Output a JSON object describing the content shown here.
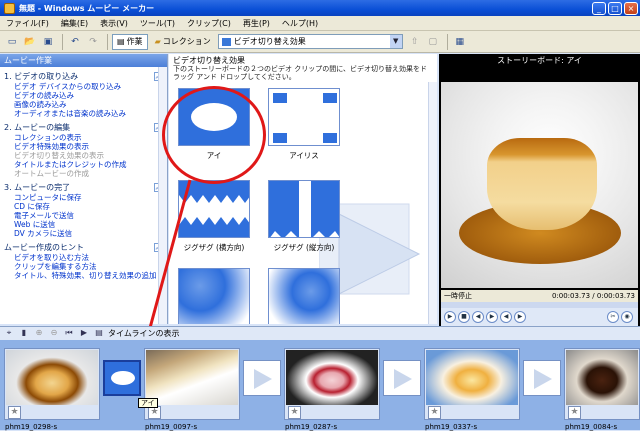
{
  "window": {
    "title": "無題 - Windows ムービー メーカー",
    "min": "_",
    "max": "□",
    "close": "×"
  },
  "menu": [
    "ファイル(F)",
    "編集(E)",
    "表示(V)",
    "ツール(T)",
    "クリップ(C)",
    "再生(P)",
    "ヘルプ(H)"
  ],
  "toolbar": {
    "tasks_label": "作業",
    "collections_label": "コレクション",
    "current_collection": "ビデオ切り替え効果"
  },
  "taskpane": {
    "title": "ムービー作業",
    "sections": [
      {
        "title": "1. ビデオの取り込み",
        "links": [
          "ビデオ デバイスからの取り込み",
          "ビデオの読み込み",
          "画像の読み込み",
          "オーディオまたは音楽の読み込み"
        ]
      },
      {
        "title": "2. ムービーの編集",
        "links": [
          "コレクションの表示",
          "ビデオ特殊効果の表示",
          "ビデオ切り替え効果の表示",
          "タイトルまたはクレジットの作成",
          "オートムービーの作成"
        ]
      },
      {
        "title": "3. ムービーの完了",
        "links": [
          "コンピュータに保存",
          "CD に保存",
          "電子メールで送信",
          "Web に送信",
          "DV カメラに送信"
        ]
      },
      {
        "title": "ムービー作成のヒント",
        "links": [
          "ビデオを取り込む方法",
          "クリップを編集する方法",
          "タイトル、特殊効果、切り替え効果の追加"
        ]
      }
    ]
  },
  "content": {
    "title": "ビデオ切り替え効果",
    "description": "下のストーリーボードの２つのビデオ クリップの間に、ビデオ切り替え効果をドラッグ アンド ドロップしてください。",
    "tiles": [
      {
        "label": "アイ"
      },
      {
        "label": "アイリス"
      },
      {
        "label": "ジグザグ (横方向)"
      },
      {
        "label": "ジグザグ (縦方向)"
      },
      {
        "label": ""
      },
      {
        "label": ""
      }
    ]
  },
  "preview": {
    "title": "ストーリーボード: アイ",
    "status": "一時停止",
    "time": "0:00:03.73 / 0:00:03.73"
  },
  "storyboard": {
    "timeline_label": "タイムラインの表示",
    "clips": [
      {
        "name": "phm19_0298-s"
      },
      {
        "name": "phm19_0097-s"
      },
      {
        "name": "phm19_0287-s"
      },
      {
        "name": "phm19_0337-s"
      },
      {
        "name": "phm19_0084-s"
      }
    ],
    "tooltip": "アイ"
  },
  "colors": {
    "accent": "#2f6fdc",
    "highlight": "#e01818",
    "titlebar": "#0a4fd6"
  }
}
